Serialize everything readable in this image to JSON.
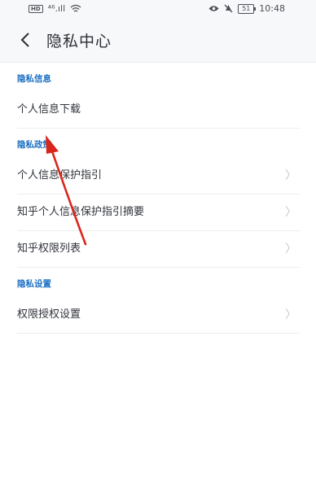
{
  "status_bar": {
    "left_text": "⁴⁶.ıll",
    "hd": "HD",
    "battery": "51",
    "time": "10:48"
  },
  "header": {
    "title": "隐私中心"
  },
  "sections": [
    {
      "title": "隐私信息",
      "items": [
        {
          "label": "个人信息下载",
          "chevron": false
        }
      ]
    },
    {
      "title": "隐私政策",
      "items": [
        {
          "label": "个人信息保护指引",
          "chevron": true
        },
        {
          "label": "知乎个人信息保护指引摘要",
          "chevron": true
        },
        {
          "label": "知乎权限列表",
          "chevron": true
        }
      ]
    },
    {
      "title": "隐私设置",
      "items": [
        {
          "label": "权限授权设置",
          "chevron": true
        }
      ]
    }
  ],
  "colors": {
    "accent": "#1b6fc2",
    "arrow": "#d9261c"
  },
  "icons": {
    "back": "chevron-left-icon",
    "item": "chevron-right-icon"
  }
}
